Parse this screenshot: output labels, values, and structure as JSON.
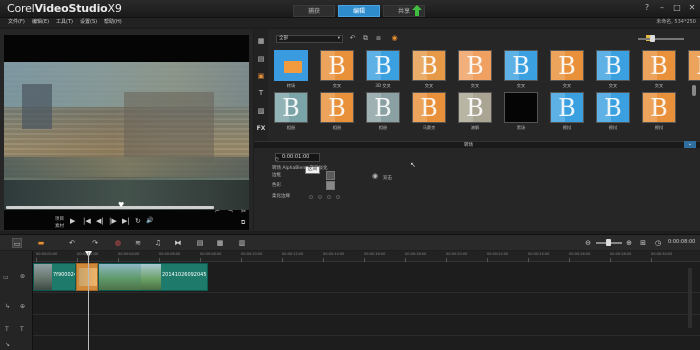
{
  "app": {
    "brand_prefix": "Corel",
    "brand_name": "VideoStudio",
    "brand_version": "X9"
  },
  "window_controls": [
    "?",
    "–",
    "□",
    "✕"
  ],
  "steps": [
    {
      "label": "捕获",
      "active": false
    },
    {
      "label": "编辑",
      "active": true
    },
    {
      "label": "共享",
      "active": false
    }
  ],
  "menu": [
    "文件(F)",
    "编辑(E)",
    "工具(T)",
    "设置(S)",
    "帮助(H)"
  ],
  "project_info": "未命名, 534*250",
  "player": {
    "labels": {
      "project": "项目",
      "clip": "素材"
    },
    "controls": [
      "▶",
      "|◀",
      "◀|",
      "|▶",
      "▶|",
      "↻",
      "🔊"
    ]
  },
  "library": {
    "filter": "全部",
    "thumbs_row1": [
      {
        "label": "转场",
        "bg": "#3a9be0",
        "kind": "folder",
        "selected": true
      },
      {
        "label": "交叉",
        "bg": "#e8903a",
        "kind": "b"
      },
      {
        "label": "3D 交叉",
        "bg": "#3aa0e0",
        "kind": "b"
      },
      {
        "label": "交叉",
        "bg": "#e69a48",
        "kind": "b"
      },
      {
        "label": "交叉",
        "bg": "#f0a060",
        "kind": "b"
      },
      {
        "label": "交叉",
        "bg": "#3aa0e0",
        "kind": "b"
      },
      {
        "label": "交叉",
        "bg": "#e8903a",
        "kind": "b"
      },
      {
        "label": "交叉",
        "bg": "#3aa0e0",
        "kind": "b"
      },
      {
        "label": "交叉",
        "bg": "#e8903a",
        "kind": "b"
      },
      {
        "label": "交叉",
        "bg": "#e8903a",
        "kind": "b"
      }
    ],
    "thumbs_row2": [
      {
        "label": "相册",
        "bg": "#7aa4a8",
        "kind": "b"
      },
      {
        "label": "相册",
        "bg": "#e8903a",
        "kind": "b"
      },
      {
        "label": "相册",
        "bg": "#8aa0a2",
        "kind": "b"
      },
      {
        "label": "马赛克",
        "bg": "#e8903a",
        "kind": "b"
      },
      {
        "label": "溶解",
        "bg": "#a9a592",
        "kind": "b"
      },
      {
        "label": "黑场",
        "bg": "#050505",
        "kind": "none"
      },
      {
        "label": "擦拭",
        "bg": "#3aa0e0",
        "kind": "b"
      },
      {
        "label": "擦拭",
        "bg": "#3aa0e0",
        "kind": "b"
      },
      {
        "label": "擦拭",
        "bg": "#e8903a",
        "kind": "b"
      }
    ]
  },
  "options": {
    "tab": "转场",
    "timecode": "0:00:01:00",
    "border_label": "边框",
    "color_label": "色彩",
    "soft_edge_label": "柔化边缘",
    "rows": [
      "转场 AlphaBlend 交叉淡化",
      "双击"
    ],
    "tooltip": "区间"
  },
  "timeline": {
    "timecode": "0:00:08:00",
    "ticks": [
      "00:00:00:00",
      "00:00:02:00",
      "00:00:04:00",
      "00:00:06:00",
      "00:00:08:00",
      "00:00:10:00",
      "00:00:12:00",
      "00:00:14:00",
      "00:00:16:00",
      "00:00:18:00",
      "00:00:20:00",
      "00:00:22:00",
      "00:00:24:00",
      "00:00:26:00",
      "00:00:28:00",
      "00:00:30:00",
      "00:00:32:00"
    ],
    "clips": [
      {
        "name": "7f900024",
        "color": "#1e7a6a"
      },
      {
        "name": "",
        "color": "#d08a3a"
      },
      {
        "name": "20141026092045_cl",
        "color": "#1e7a6a"
      }
    ]
  }
}
